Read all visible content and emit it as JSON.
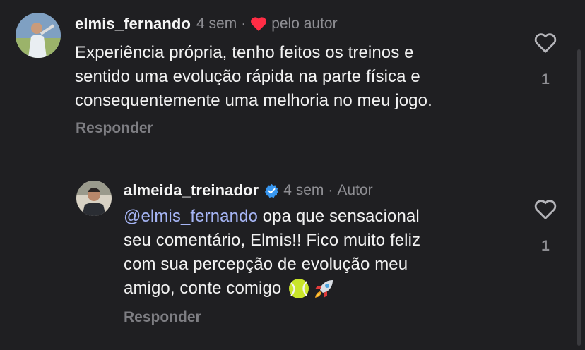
{
  "comments": [
    {
      "username": "elmis_fernando",
      "time": "4 sem",
      "separator": "·",
      "liked_by_author": "pelo autor",
      "text": "Experiência própria, tenho feitos os treinos e sentido uma evolução rápida na parte física e consequentemente uma melhoria no meu jogo.",
      "text_lines": [
        "Experiência própria, tenho feitos os treinos e",
        "sentido uma evolução rápida na parte física e",
        "consequentemente uma melhoria no meu jogo."
      ],
      "reply_label": "Responder",
      "like_count": "1"
    },
    {
      "username": "almeida_treinador",
      "verified": true,
      "time": "4 sem",
      "separator": "·",
      "author_badge": "Autor",
      "mention": "@elmis_fernando",
      "text_lines": [
        " opa que sensacional",
        "seu comentário, Elmis!! Fico muito feliz",
        "com sua percepção de evolução meu",
        "amigo, conte comigo "
      ],
      "emojis": [
        "tennis-ball-icon",
        "rocket-icon"
      ],
      "reply_label": "Responder",
      "like_count": "1"
    }
  ],
  "colors": {
    "background": "#1f1f22",
    "heart_red": "#ff2d45",
    "verified_blue": "#3897f0",
    "mention": "#a6b5f5"
  }
}
